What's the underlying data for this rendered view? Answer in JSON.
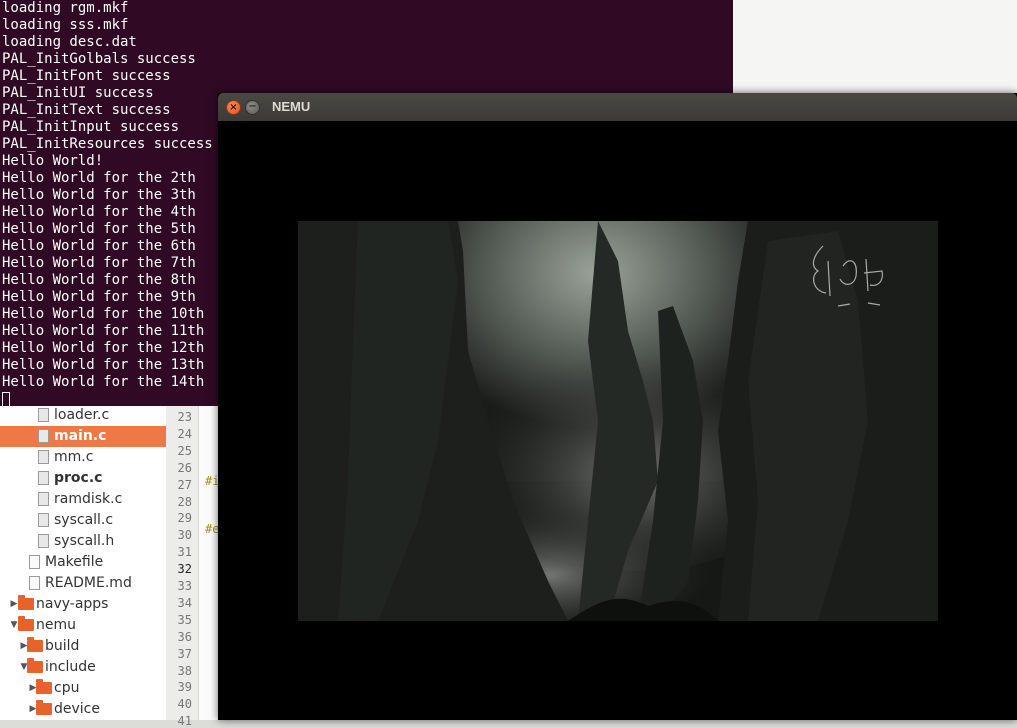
{
  "terminal": {
    "lines": [
      "loading rgm.mkf",
      "loading sss.mkf",
      "loading desc.dat",
      "PAL_InitGolbals success",
      "PAL_InitFont success",
      "PAL_InitUI success",
      "PAL_InitText success",
      "PAL_InitInput success",
      "PAL_InitResources success",
      "Hello World!",
      "Hello World for the 2th",
      "Hello World for the 3th",
      "Hello World for the 4th",
      "Hello World for the 5th",
      "Hello World for the 6th",
      "Hello World for the 7th",
      "Hello World for the 8th",
      "Hello World for the 9th",
      "Hello World for the 10th",
      "Hello World for the 11th",
      "Hello World for the 12th",
      "Hello World for the 13th",
      "Hello World for the 14th"
    ]
  },
  "nemu_window": {
    "title": "NEMU",
    "close_glyph": "×",
    "minimize_glyph": "−"
  },
  "file_tree": {
    "items": [
      {
        "label": "loader.c",
        "kind": "file"
      },
      {
        "label": "main.c",
        "kind": "file",
        "selected": true,
        "bold": true
      },
      {
        "label": "mm.c",
        "kind": "file"
      },
      {
        "label": "proc.c",
        "kind": "file",
        "bold": true
      },
      {
        "label": "ramdisk.c",
        "kind": "file"
      },
      {
        "label": "syscall.c",
        "kind": "file"
      },
      {
        "label": "syscall.h",
        "kind": "file"
      },
      {
        "label": "Makefile",
        "kind": "file"
      },
      {
        "label": "README.md",
        "kind": "file"
      },
      {
        "label": "navy-apps",
        "kind": "folder",
        "expanded": false
      },
      {
        "label": "nemu",
        "kind": "folder",
        "expanded": true
      },
      {
        "label": "build",
        "kind": "folder",
        "expanded": false
      },
      {
        "label": "include",
        "kind": "folder",
        "expanded": true
      },
      {
        "label": "cpu",
        "kind": "folder",
        "expanded": false
      },
      {
        "label": "device",
        "kind": "folder",
        "expanded": false
      }
    ]
  },
  "editor": {
    "line_numbers": [
      "23",
      "24",
      "25",
      "26",
      "27",
      "28",
      "29",
      "30",
      "31",
      "32",
      "33",
      "34",
      "35",
      "36",
      "37",
      "38",
      "39",
      "40",
      "41"
    ],
    "current_line": "32",
    "code_fragments": [
      "#i",
      "#e"
    ]
  },
  "colors": {
    "terminal_bg": "#300a24",
    "selection": "#f07746",
    "folder": "#e8622c",
    "preproc": "#a59314"
  }
}
